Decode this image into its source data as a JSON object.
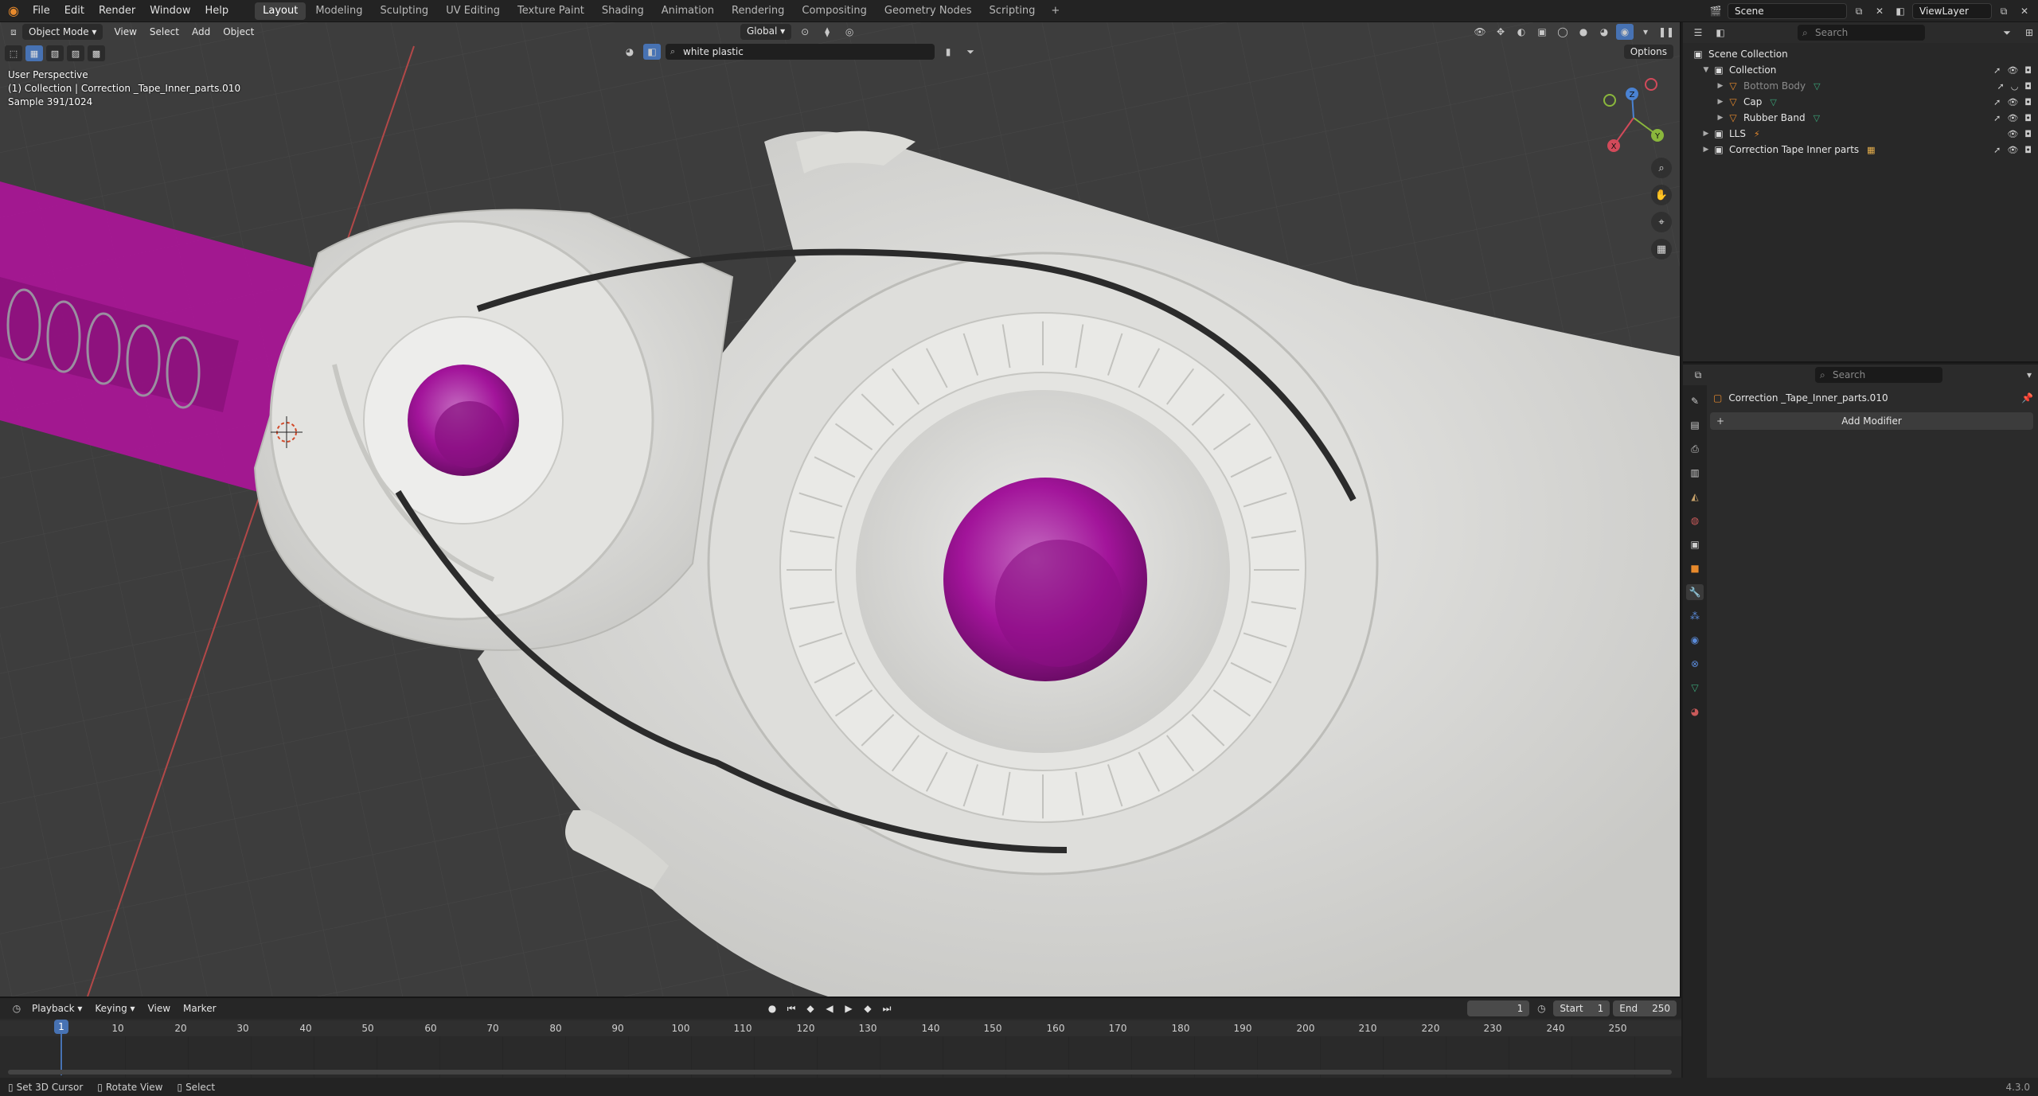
{
  "menu": {
    "items": [
      "File",
      "Edit",
      "Render",
      "Window",
      "Help"
    ],
    "workspaces": [
      "Layout",
      "Modeling",
      "Sculpting",
      "UV Editing",
      "Texture Paint",
      "Shading",
      "Animation",
      "Rendering",
      "Compositing",
      "Geometry Nodes",
      "Scripting"
    ],
    "active_workspace": "Layout",
    "add_label": "+"
  },
  "topbar": {
    "scene": "Scene",
    "view_layer": "ViewLayer"
  },
  "viewport": {
    "mode": "Object Mode",
    "menus": [
      "View",
      "Select",
      "Add",
      "Object"
    ],
    "transform_orientation": "Global",
    "material_search": "white plastic",
    "options_label": "Options",
    "overlay": {
      "line1": "User Perspective",
      "line2": "(1) Collection | Correction _Tape_Inner_parts.010",
      "line3": "Sample 391/1024"
    },
    "gizmo": {
      "x": "X",
      "y": "Y",
      "z": "Z"
    }
  },
  "timeline": {
    "menus": [
      "Playback",
      "Keying",
      "View",
      "Marker"
    ],
    "current_frame": "1",
    "start_label": "Start",
    "start": "1",
    "end_label": "End",
    "end": "250",
    "playhead": "1",
    "ticks": [
      "10",
      "20",
      "30",
      "40",
      "50",
      "60",
      "70",
      "80",
      "90",
      "100",
      "110",
      "120",
      "130",
      "140",
      "150",
      "160",
      "170",
      "180",
      "190",
      "200",
      "210",
      "220",
      "230",
      "240",
      "250"
    ]
  },
  "statusbar": {
    "items": [
      "Set 3D Cursor",
      "Rotate View",
      "Select"
    ],
    "version": "4.3.0"
  },
  "outliner": {
    "search_placeholder": "Search",
    "scene_collection": "Scene Collection",
    "collection": "Collection",
    "children": [
      {
        "name": "Bottom Body",
        "dim": true
      },
      {
        "name": "Cap",
        "dim": false
      },
      {
        "name": "Rubber Band",
        "dim": false
      }
    ],
    "lls": "LLS",
    "inner_parts": "Correction Tape Inner parts"
  },
  "properties": {
    "search_placeholder": "Search",
    "object_name": "Correction _Tape_Inner_parts.010",
    "add_modifier": "Add Modifier"
  },
  "colors": {
    "accent": "#4772b3",
    "magenta": "#b0139c",
    "plastic": "#d9d9d6",
    "orange": "#e88a2c"
  }
}
